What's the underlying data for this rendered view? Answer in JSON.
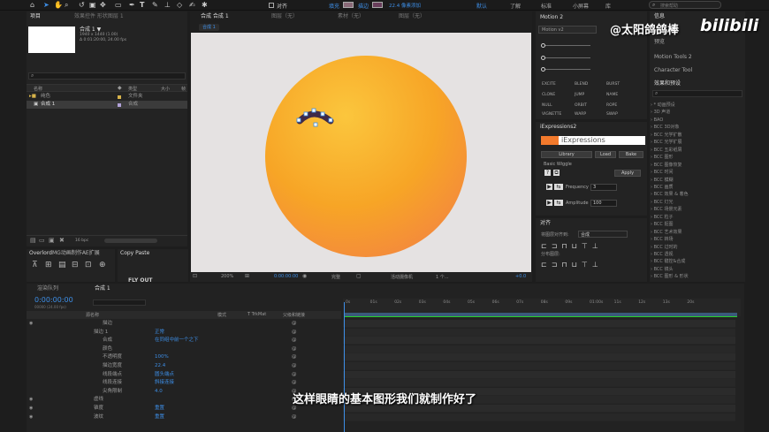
{
  "toolbar": {
    "align_check": "对齐",
    "fill_label": "填充",
    "stroke_label": "描边",
    "stroke_add": "22.4 像素添加",
    "default_label": "默认",
    "learn": "了解",
    "standard": "标准",
    "small_screen": "小屏幕",
    "library": "库",
    "search_help": "搜索帮助"
  },
  "watermark": {
    "channel": "@太阳鸽鸽棒",
    "brand": "bilibili"
  },
  "project": {
    "tab": "项目",
    "effects_tab": "效果控件 形状图层 1",
    "comp_name": "合成 1 ▼",
    "comp_info1": "1940 x 1440 (1.00)",
    "comp_info2": "Δ 0:01:20:00, 24.00 fps",
    "search_ph": "",
    "cols": {
      "name": "名称",
      "type": "类型",
      "size": "大小",
      "frame": "帧"
    },
    "items": [
      {
        "name": "纯色",
        "type": "文件夹"
      },
      {
        "name": "合成 1",
        "type": "合成"
      }
    ],
    "bpc": "16 bpc"
  },
  "overlord": {
    "tab": "Overlord",
    "tab2": "MG动画制作AE扩展",
    "copy_tab": "Copy Paste",
    "bottom_text": "FLY OUT"
  },
  "comp_panel": {
    "tab": "合成 合成 1",
    "tab_layer": "图层（无）",
    "tab_footage": "素材（无）",
    "tab_graph": "图层（无）",
    "breadcrumb": "合成 1",
    "zoom": "200%",
    "timecode": "0:00:00:00",
    "resolution": "完整",
    "camera": "活动摄像机",
    "views": "1 个...",
    "exposure": "+0.0"
  },
  "motion": {
    "tab": "Motion 2",
    "version": "Motion v2",
    "buttons": [
      "EXCITE",
      "BLEND",
      "BURST",
      "CLONE",
      "JUMP",
      "NAME",
      "NULL",
      "ORBIT",
      "ROPE",
      "VIGNETTE",
      "WARP",
      "SWAP"
    ]
  },
  "iexp": {
    "tab": "iExpressions2",
    "logo": "iExpressions",
    "tabs": [
      "Library",
      "Load",
      "Bake"
    ],
    "wiggle_title": "Basic Wiggle",
    "apply": "Apply",
    "frequency_label": "Frequency",
    "frequency_value": "3",
    "amplitude_label": "Amplitude",
    "amplitude_value": "100"
  },
  "align": {
    "tab": "对齐",
    "align_to_label": "将图层对齐到:",
    "align_to_value": "合成",
    "distribute": "分布图层:"
  },
  "right": {
    "info_tab": "信息",
    "audio_tab": "音频",
    "preview_tab": "预览",
    "motion_tools": "Motion Tools 2",
    "character": "Character Tool",
    "effects_title": "效果和预设",
    "search_ph": "",
    "effects": [
      "* 动画预设",
      "3D 声道",
      "BAO",
      "BCC 3D对象",
      "BCC 光学扩散",
      "BCC 光学扩展",
      "BCC 五彩纸屑",
      "BCC 图形",
      "BCC 图像恢复",
      "BCC 时间",
      "BCC 模糊",
      "BCC 画质",
      "BCC 效果 & 着色",
      "BCC 灯光",
      "BCC 场景元素",
      "BCC 粒子",
      "BCC 抠图",
      "BCC 艺术效果",
      "BCC 转场",
      "BCC 过时的",
      "BCC 透视",
      "BCC 键控&合成",
      "BCC 镜头",
      "BCC 图形 & 形状"
    ]
  },
  "timeline": {
    "render_tab": "渲染队列",
    "comp_tab": "合成 1",
    "timecode": "0:00:00:00",
    "timecode_sub": "00000 (24.00 fps)",
    "cols": {
      "name": "源名称",
      "mode": "模式",
      "trkmat": "T TrkMat",
      "parent": "父级和链接"
    },
    "layers": [
      {
        "name": "描边",
        "val": ""
      },
      {
        "name": "描边 1",
        "val": "正常"
      },
      {
        "name": "合成",
        "val": "在同组中前一个之下"
      },
      {
        "name": "颜色",
        "val": ""
      },
      {
        "name": "不透明度",
        "val": "100%"
      },
      {
        "name": "描边宽度",
        "val": "22.4"
      },
      {
        "name": "线段端点",
        "val": "圆头端点"
      },
      {
        "name": "线段连接",
        "val": "斜接连接"
      },
      {
        "name": "尖角限制",
        "val": "4.0"
      },
      {
        "name": "虚线",
        "val": ""
      },
      {
        "name": "锥度",
        "val": "重置"
      },
      {
        "name": "波纹",
        "val": "重置"
      }
    ],
    "ruler": [
      "0s",
      "01s",
      "02s",
      "03s",
      "04s",
      "05s",
      "06s",
      "07s",
      "08s",
      "09s",
      "01:00s",
      "11s",
      "12s",
      "13s",
      "20s"
    ]
  },
  "subtitle": "这样眼睛的基本图形我们就制作好了",
  "colors": {
    "orange": "#f7a91f",
    "selection": "#3d8ee6",
    "stroke_color": "#6a3f5c"
  }
}
